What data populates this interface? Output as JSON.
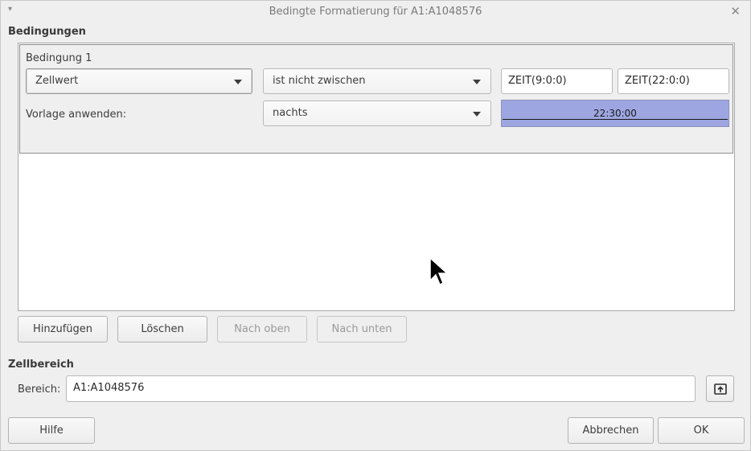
{
  "window": {
    "title": "Bedingte Formatierung für A1:A1048576",
    "menu_glyph": "▾",
    "close_glyph": "✕"
  },
  "conditions": {
    "section_label": "Bedingungen",
    "entries": [
      {
        "label": "Bedingung 1",
        "type_select": "Zellwert",
        "operator_select": "ist nicht zwischen",
        "value1": "ZEIT(9:0:0)",
        "value2": "ZEIT(22:0:0)",
        "apply_style_label": "Vorlage anwenden:",
        "style_select": "nachts",
        "preview_text": "22:30:00",
        "preview_color": "#9ea6e2"
      }
    ]
  },
  "actions": {
    "add": "Hinzufügen",
    "delete": "Löschen",
    "up": "Nach oben",
    "down": "Nach unten"
  },
  "cell_range": {
    "section_label": "Zellbereich",
    "range_label": "Bereich:",
    "range_value": "A1:A1048576",
    "shrink_icon": "shrink-range-icon"
  },
  "footer": {
    "help": "Hilfe",
    "cancel": "Abbrechen",
    "ok": "OK"
  }
}
